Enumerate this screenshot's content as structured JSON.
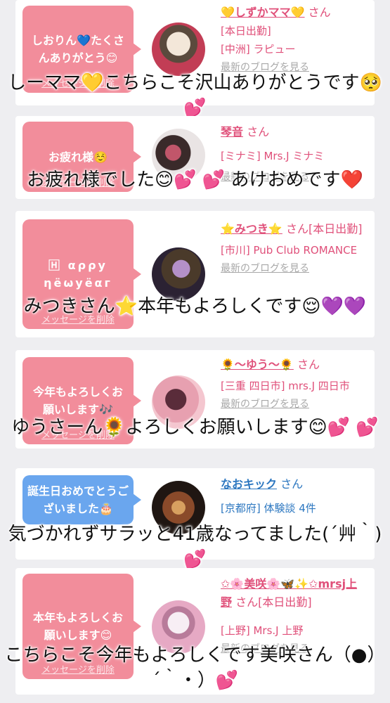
{
  "items": [
    {
      "bubble": "しおりん💙たくさんありがとう😊",
      "delete_label": "メッセージを削除",
      "name": "💛しずかママ💛",
      "suffix": "さん",
      "lines": [
        "[本日出勤]",
        "[中洲] ラピュー"
      ],
      "blog": "最新のブログを見る",
      "reply": "しーママ💛こちらこそ沢山ありがとうです🥺💕",
      "theme": "pink",
      "avatar_colors": [
        "#f3e7d9",
        "#c23d55",
        "#5a4a3d"
      ]
    },
    {
      "bubble": "お疲れ様☺️",
      "delete_label": "メッセージを削除",
      "name": "琴音",
      "suffix": "さん",
      "lines": [
        "[ミナミ] Mrs.J ミナミ"
      ],
      "blog": "最新のブログを見る",
      "reply": "お疲れ様でした😊💕 💕 あけおめです❤️",
      "theme": "pink",
      "avatar_colors": [
        "#e9e4e4",
        "#3a2a2a",
        "#c1566a"
      ]
    },
    {
      "bubble": "🄷 αρρу ηёωуёαг",
      "delete_label": "メッセージを削除",
      "name": "⭐みつき⭐",
      "suffix": "さん[本日出勤]",
      "lines": [
        "[市川] Pub Club ROMANCE"
      ],
      "blog": "最新のブログを見る",
      "reply": "みつきさん⭐本年もよろしくです😌💜💜",
      "theme": "pink",
      "avatar_colors": [
        "#2b2233",
        "#b490c8",
        "#4a3a2a"
      ]
    },
    {
      "bubble": "今年もよろしくお願いします🎶",
      "delete_label": "メッセージを削除",
      "name": "🌻〜ゆう〜🌻",
      "suffix": "さん",
      "lines": [
        "[三重 四日市] mrs.J 四日市"
      ],
      "blog": "最新のブログを見る",
      "reply": "ゆうさーん🌻よろしくお願いします😊💕 💕",
      "theme": "pink",
      "avatar_colors": [
        "#f4c6cf",
        "#5a2c3a",
        "#e7a0b0"
      ]
    },
    {
      "bubble": "誕生日おめでとうございました🎂",
      "delete_label": "",
      "name": "なおキック",
      "suffix": "さん",
      "lines": [
        "[京都府] 体験談 4件"
      ],
      "blog": "",
      "reply": "気づかれずサラッと41歳なってました(´艸｀)💕",
      "theme": "blue",
      "avatar_colors": [
        "#1f1612",
        "#8a4a2a",
        "#d8a060"
      ]
    },
    {
      "bubble": "本年もよろしくお願いします😊",
      "delete_label": "メッセージを削除",
      "name": "✩🌸美咲🌸🦋✨✩mrsj上野",
      "suffix": "さん[本日出勤]",
      "lines": [
        "[上野] Mrs.J 上野"
      ],
      "blog": "最新のブログを見る",
      "reply": "こちらこそ今年もよろしくです美咲さん（●）´｀・）💕",
      "theme": "pink",
      "avatar_colors": [
        "#f7eef4",
        "#e6a9c4",
        "#b87b9a"
      ]
    }
  ]
}
